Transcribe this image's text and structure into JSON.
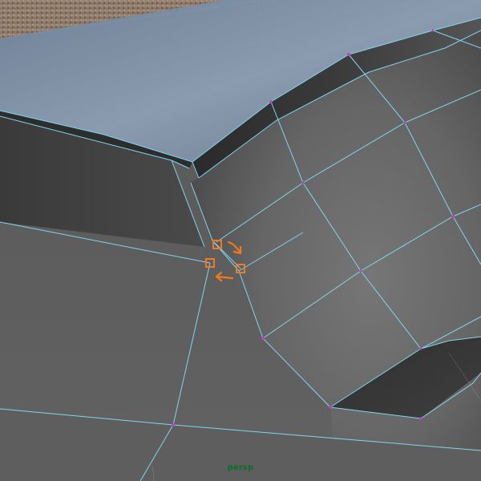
{
  "viewport": {
    "camera_label": "persp"
  },
  "colors": {
    "wireframe": "#7fd6ee",
    "vertex": "#c03ec8",
    "selection_marker": "#f07a1e",
    "background_texture": "#8f7b6b",
    "top_surface": "#7f92a6"
  },
  "icons": {
    "arrow_right_down": "arrow-right-down-icon",
    "arrow_left": "arrow-left-icon"
  }
}
